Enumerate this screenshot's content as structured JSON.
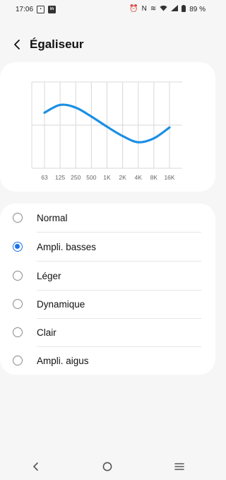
{
  "status_bar": {
    "time": "17:06",
    "left_icons": [
      "notification-box-icon",
      "linkedin-icon"
    ],
    "right_icons": [
      "alarm-icon",
      "nfc-icon",
      "vibrate-icon",
      "wifi-icon",
      "signal-icon",
      "battery-icon"
    ],
    "battery": "89 %"
  },
  "header": {
    "title": "Égaliseur",
    "back_icon": "back-arrow-icon"
  },
  "equalizer": {
    "bands": [
      "63",
      "125",
      "250",
      "500",
      "1K",
      "2K",
      "4K",
      "8K",
      "16K"
    ],
    "levels": [
      0.32,
      0.52,
      0.45,
      0.22,
      -0.04,
      -0.28,
      -0.44,
      -0.34,
      -0.06
    ],
    "range": [
      -1,
      1
    ],
    "curve_color": "#1a8fe3",
    "grid_color": "#d8d8d8"
  },
  "presets": {
    "selected": "Ampli. basses",
    "options": [
      "Normal",
      "Ampli. basses",
      "Léger",
      "Dynamique",
      "Clair",
      "Ampli. aigus"
    ]
  },
  "accent_color": "#1a73e8",
  "nav_bar": {
    "icons": [
      "back-icon",
      "home-icon",
      "recents-icon"
    ]
  }
}
